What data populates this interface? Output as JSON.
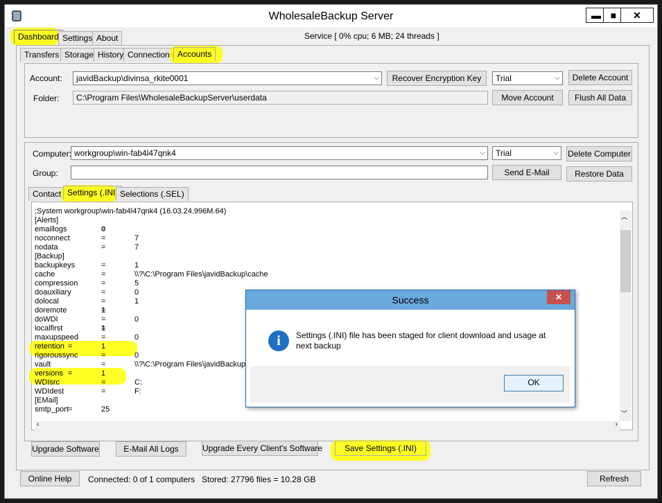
{
  "window": {
    "title": "WholesaleBackup Server",
    "minimize": "▬",
    "maximize": "■",
    "close": "✕",
    "icon": "app-icon"
  },
  "main_tabs": [
    "Dashboard",
    "Settings",
    "About"
  ],
  "service_status": "Service [  0% cpu;  6 MB; 24 threads ]",
  "sub_tabs": [
    "Transfers",
    "Storage",
    "History",
    "Connections",
    "Accounts"
  ],
  "account": {
    "label": "Account:",
    "value": "javidBackup\\divinsa_rkite0001",
    "folder_label": "Folder:",
    "folder_value": "C:\\Program Files\\WholesaleBackupServer\\userdata",
    "plan": "Trial",
    "recover_key_button": "Recover Encryption Key",
    "delete_account_button": "Delete Account",
    "move_account_button": "Move Account",
    "flush_button": "Flush All Data"
  },
  "computer": {
    "label": "Computer:",
    "value": "workgroup\\win-fab4l47qnk4",
    "group_label": "Group:",
    "group_value": "",
    "plan": "Trial",
    "delete_computer_button": "Delete Computer",
    "send_email_button": "Send E-Mail",
    "restore_button": "Restore Data"
  },
  "detail_tabs": [
    "Contact",
    "Settings (.INI)",
    "Selections (.SEL)"
  ],
  "ini": {
    "system_line": ";System    workgroup\\win-fab4l47qnk4 (16.03.24.996M.64)",
    "sections": [
      "[Alerts]",
      "[Backup]",
      "[EMail]"
    ],
    "alerts": [
      {
        "key": "emaillogs",
        "eq": "=",
        "value": "0"
      },
      {
        "key": "noconnect",
        "eq": "=",
        "value": "7"
      },
      {
        "key": "nodata",
        "eq": "=",
        "value": "7"
      }
    ],
    "backup": [
      {
        "key": "backupkeys",
        "eq": "=",
        "value": "1"
      },
      {
        "key": "cache",
        "eq": "=",
        "value": "\\\\?\\C:\\Program Files\\javidBackup\\cache"
      },
      {
        "key": "compression",
        "eq": "=",
        "value": "5"
      },
      {
        "key": "doauxiliary",
        "eq": "=",
        "value": "0"
      },
      {
        "key": "dolocal",
        "eq": "=",
        "value": "1"
      },
      {
        "key": "doremote",
        "eq": "=",
        "value": "1"
      },
      {
        "key": "doWDI",
        "eq": "=",
        "value": "0"
      },
      {
        "key": "localfirst",
        "eq": "=",
        "value": "1"
      },
      {
        "key": "maxupspeed",
        "eq": "=",
        "value": "0"
      },
      {
        "key": "retention",
        "eq": "=",
        "value": "1"
      },
      {
        "key": "rigoroussync",
        "eq": "=",
        "value": "0"
      },
      {
        "key": "vault",
        "eq": "=",
        "value": "\\\\?\\C:\\Program Files\\javidBackup"
      },
      {
        "key": "versions",
        "eq": "=",
        "value": "1"
      },
      {
        "key": "WDIsrc",
        "eq": "=",
        "value": "C:"
      },
      {
        "key": "WDIdest",
        "eq": "=",
        "value": "F:"
      }
    ],
    "email": [
      {
        "key": "smtp_port",
        "eq": "=",
        "value": "25"
      }
    ]
  },
  "dialog": {
    "title": "Success",
    "message_line1": "Settings (.INI) file has been staged for client download and usage at",
    "message_line2": "next backup",
    "ok_button": "OK",
    "icon": "info-icon"
  },
  "bottom_buttons": {
    "upgrade_software": "Upgrade Software",
    "email_all_logs": "E-Mail All Logs",
    "upgrade_every_client": "Upgrade Every Client's Software",
    "save_settings": "Save Settings (.INI)"
  },
  "status_bar": {
    "online_help": "Online Help",
    "connected": "Connected: 0 of 1 computers",
    "stored": "Stored: 27796 files = 10.28 GB",
    "refresh": "Refresh"
  },
  "colors": {
    "highlight": "#ffff00",
    "dialog_title": "#6aa9dd",
    "close_red": "#c75050",
    "info_blue": "#1f6fc5"
  }
}
